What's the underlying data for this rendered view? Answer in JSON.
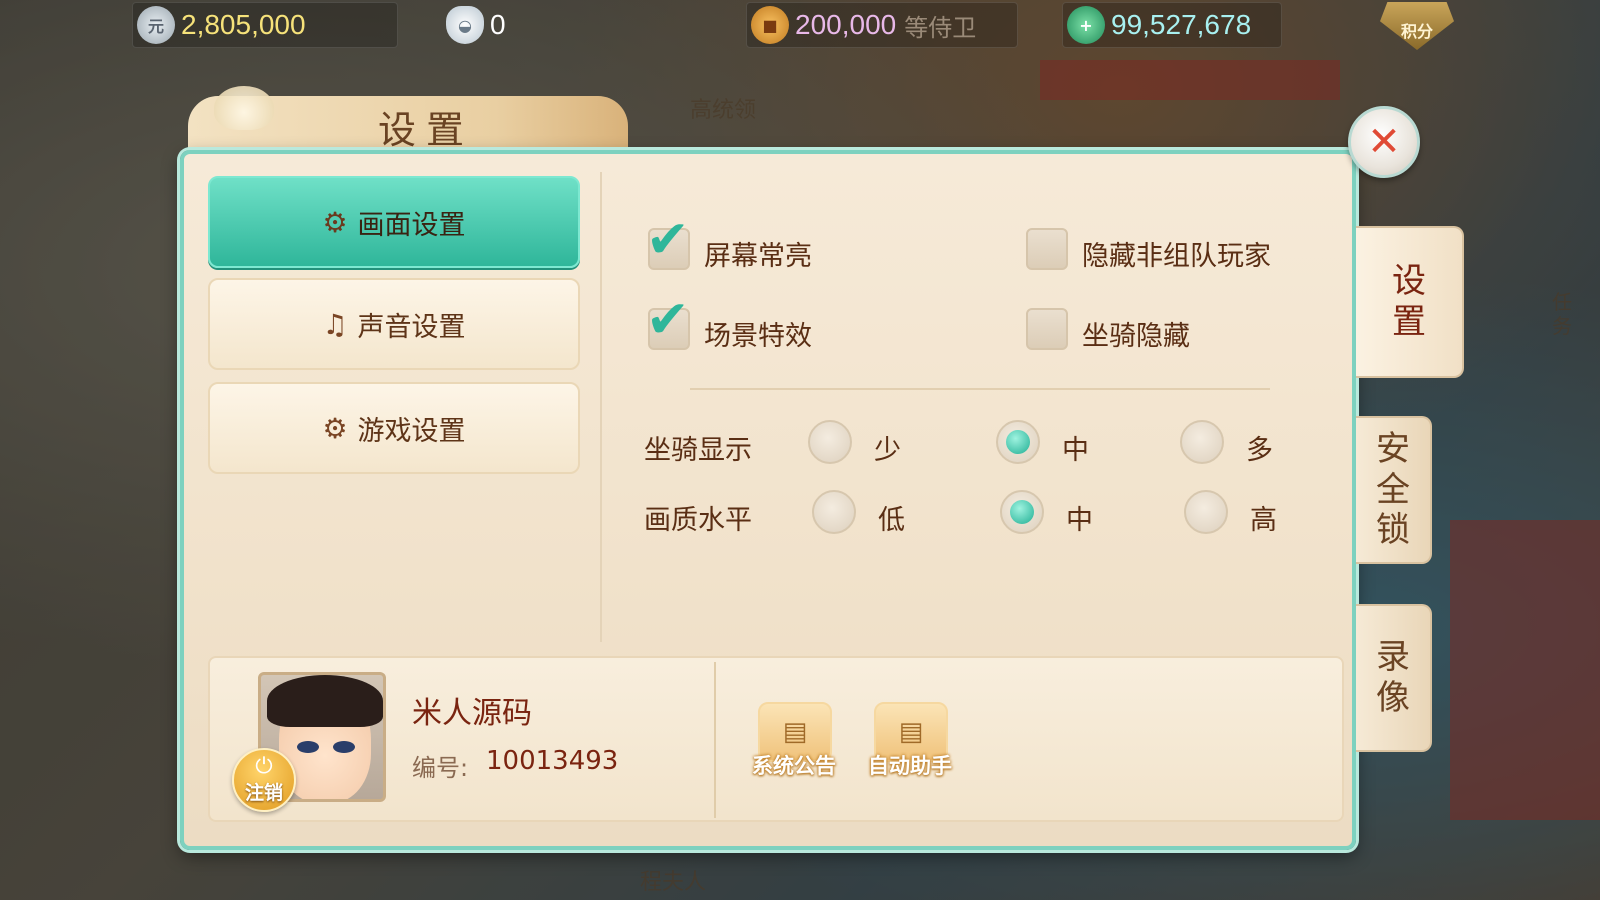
{
  "top_bar": {
    "currencies": [
      {
        "name": "silver",
        "icon": "silver-coin-icon",
        "value": "2,805,000",
        "color": "#f6e27a"
      },
      {
        "name": "ingot",
        "icon": "silver-ingot-icon",
        "value": "0",
        "color": "#ffffff"
      },
      {
        "name": "copper",
        "icon": "copper-coin-icon",
        "value": "200,000",
        "sub": "等侍卫",
        "color": "#e8b8e8"
      },
      {
        "name": "jade",
        "icon": "jade-add-icon",
        "value": "99,527,678",
        "color": "#a8f0f0"
      }
    ],
    "points_badge": "积分"
  },
  "background_labels": [
    "高统领",
    "程夫人",
    "任务"
  ],
  "panel": {
    "title": "设置",
    "menu": [
      {
        "label": "画面设置",
        "icon": "gear-icon",
        "active": true
      },
      {
        "label": "声音设置",
        "icon": "music-note-icon",
        "active": false
      },
      {
        "label": "游戏设置",
        "icon": "gears-icon",
        "active": false
      }
    ],
    "checkboxes": [
      {
        "label": "屏幕常亮",
        "checked": true
      },
      {
        "label": "隐藏非组队玩家",
        "checked": false
      },
      {
        "label": "场景特效",
        "checked": true
      },
      {
        "label": "坐骑隐藏",
        "checked": false
      }
    ],
    "radio_groups": [
      {
        "label": "坐骑显示",
        "options": [
          "少",
          "中",
          "多"
        ],
        "selected": "中"
      },
      {
        "label": "画质水平",
        "options": [
          "低",
          "中",
          "高"
        ],
        "selected": "中"
      }
    ],
    "player": {
      "name": "米人源码",
      "id_label": "编号:",
      "id": "10013493",
      "logout_label": "注销"
    },
    "functions": [
      {
        "label": "系统公告",
        "icon": "scroll-icon"
      },
      {
        "label": "自动助手",
        "icon": "scroll-icon"
      }
    ]
  },
  "side_tabs": [
    {
      "label": "设置",
      "active": true
    },
    {
      "label": "安全锁",
      "active": false
    },
    {
      "label": "录像",
      "active": false
    }
  ],
  "colors": {
    "accent": "#2fb69a",
    "text": "#5a2e14",
    "close": "#e04a35"
  }
}
